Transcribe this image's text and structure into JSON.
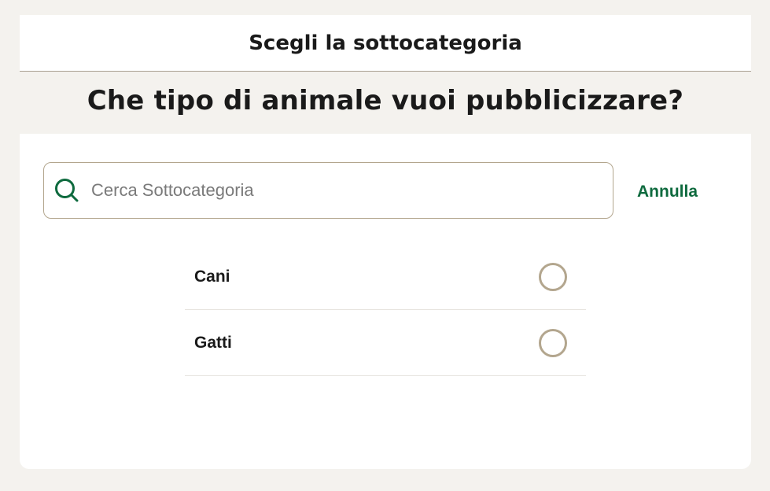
{
  "header": {
    "title": "Scegli la sottocategoria"
  },
  "question": "Che tipo di animale vuoi pubblicizzare?",
  "search": {
    "placeholder": "Cerca Sottocategoria",
    "value": "",
    "icon": "search-icon"
  },
  "cancel_label": "Annulla",
  "options": [
    {
      "label": "Cani",
      "selected": false
    },
    {
      "label": "Gatti",
      "selected": false
    }
  ],
  "colors": {
    "accent": "#0e6a3e",
    "radio_border": "#b3a68e",
    "background": "#f4f2ee"
  }
}
